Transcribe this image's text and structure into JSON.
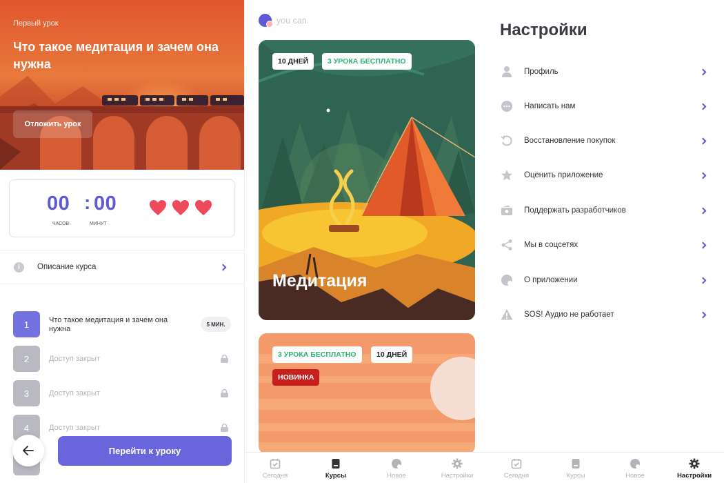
{
  "lesson_screen": {
    "eyebrow": "Первый урок",
    "title": "Что такое медитация и зачем она нужна",
    "postpone_label": "Отложить урок",
    "timer": {
      "hours": "00",
      "minutes": "00",
      "separator": ":",
      "hours_label": "часов",
      "minutes_label": "минут"
    },
    "hearts": 3,
    "description_label": "Описание курса",
    "lessons": [
      {
        "num": "1",
        "title": "Что такое медитация и зачем она нужна",
        "duration": "5 МИН.",
        "locked": false
      },
      {
        "num": "2",
        "title": "Доступ закрыт",
        "locked": true
      },
      {
        "num": "3",
        "title": "Доступ закрыт",
        "locked": true
      },
      {
        "num": "4",
        "title": "Доступ закрыт",
        "locked": true
      }
    ],
    "go_button": "Перейти к уроку"
  },
  "courses_screen": {
    "brand": "you can.",
    "card1": {
      "pill_days": "10 ДНЕЙ",
      "pill_free": "3 УРОКА БЕСПЛАТНО",
      "title": "Медитация"
    },
    "card2": {
      "pill_free": "3 УРОКА БЕСПЛАТНО",
      "pill_days": "10 ДНЕЙ",
      "pill_new": "НОВИНКА"
    }
  },
  "tabs": [
    "Сегодня",
    "Курсы",
    "Новое",
    "Настройки"
  ],
  "settings_screen": {
    "title": "Настройки",
    "items": [
      {
        "label": "Профиль",
        "icon": "person-icon"
      },
      {
        "label": "Написать нам",
        "icon": "chat-bubble-icon"
      },
      {
        "label": "Восстановление покупок",
        "icon": "restore-icon"
      },
      {
        "label": "Оценить приложение",
        "icon": "star-icon"
      },
      {
        "label": "Поддержать разработчиков",
        "icon": "money-icon"
      },
      {
        "label": "Мы в соцсетях",
        "icon": "share-icon"
      },
      {
        "label": "О приложении",
        "icon": "app-info-icon"
      },
      {
        "label": "SOS! Аудио не работает",
        "icon": "warning-icon"
      }
    ]
  },
  "colors": {
    "accent": "#5d5ad3",
    "button": "#6b65dd",
    "heart": "#ee4a5c",
    "green_text": "#2bb37a",
    "badge_new": "#c81e1e"
  }
}
